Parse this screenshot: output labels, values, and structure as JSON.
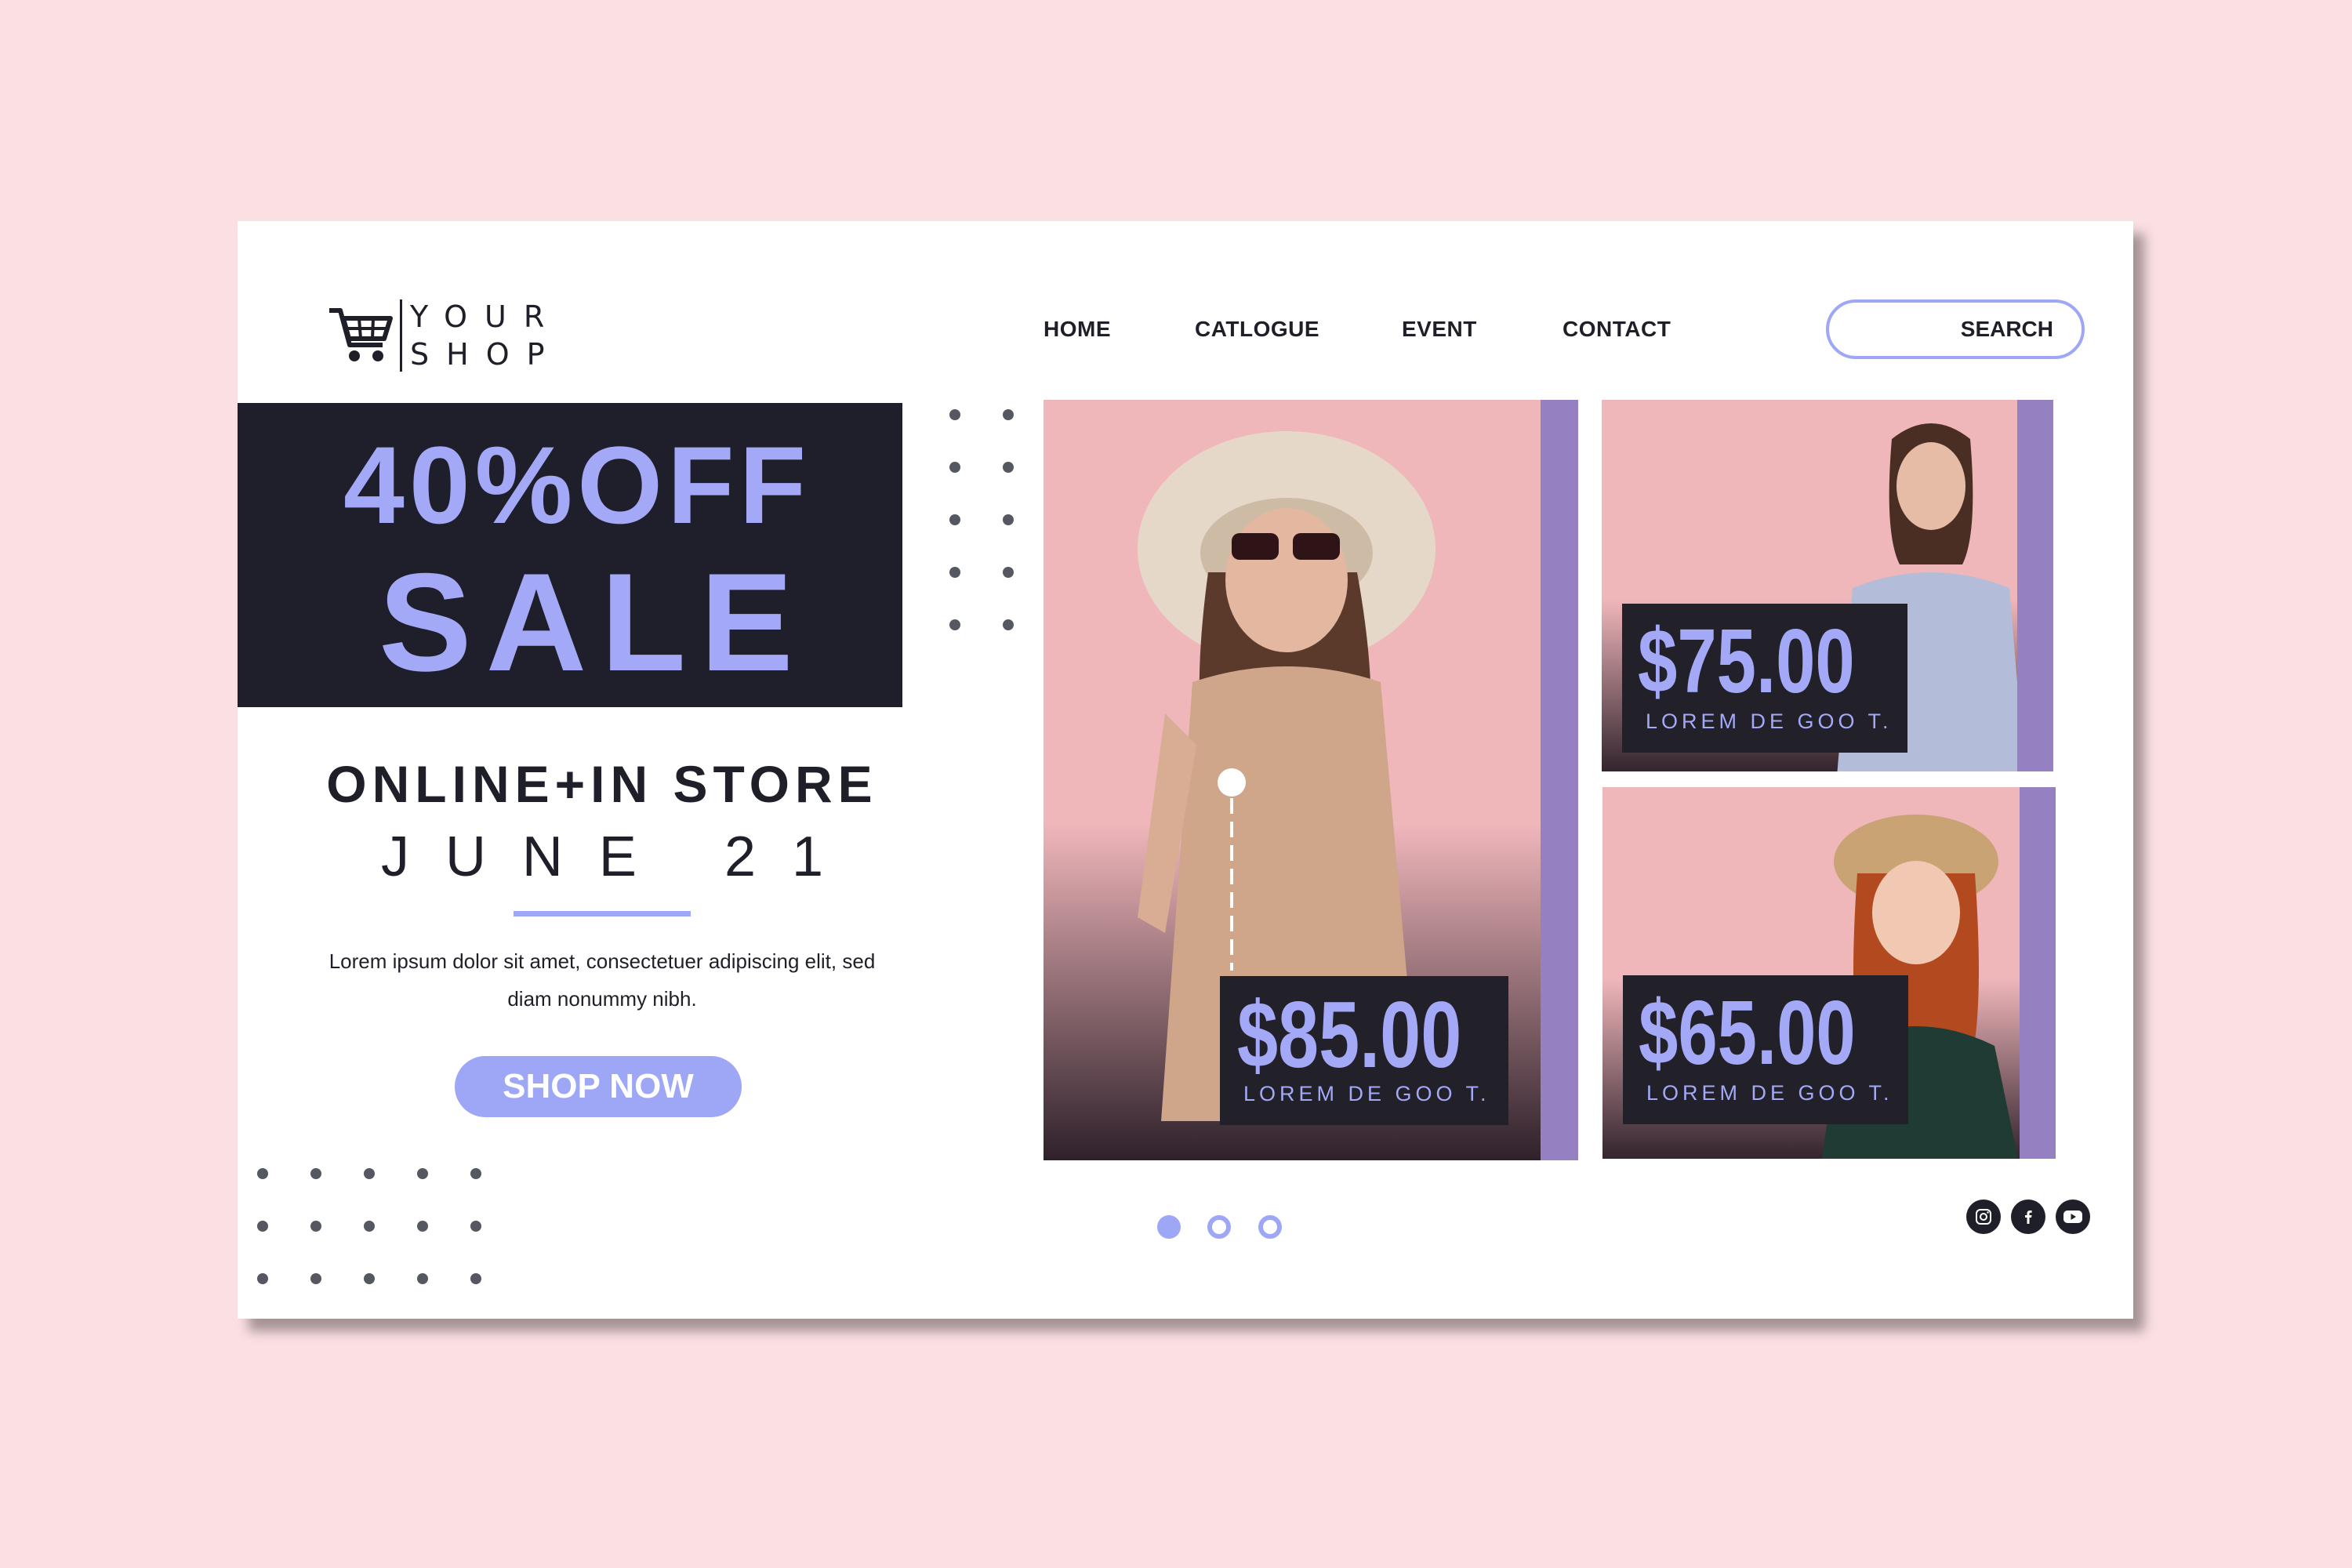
{
  "logo": {
    "line1": "YOUR",
    "line2": "SHOP",
    "icon": "shopping-cart-icon"
  },
  "nav": {
    "home": "HOME",
    "catalogue": "CATLOGUE",
    "event": "EVENT",
    "contact": "CONTACT",
    "search_label": "SEARCH"
  },
  "hero": {
    "discount": "40%OFF",
    "sale": "SALE",
    "channels": "ONLINE+IN STORE",
    "date": "JUNE 21",
    "description": "Lorem ipsum dolor sit amet, consectetuer adipiscing elit, sed diam nonummy nibh.",
    "cta": "SHOP NOW"
  },
  "products": [
    {
      "price": "$85.00",
      "caption": "LOREM DE GOO T."
    },
    {
      "price": "$75.00",
      "caption": "LOREM DE GOO T."
    },
    {
      "price": "$65.00",
      "caption": "LOREM DE GOO T."
    }
  ],
  "pagination": {
    "pages": 3,
    "active": 1
  },
  "social": [
    "instagram-icon",
    "facebook-icon",
    "youtube-icon"
  ],
  "colors": {
    "background": "#fbe0e3",
    "accent": "#9ea7f5",
    "dark": "#1f1f2b",
    "stripe": "#9580c2",
    "photo_pink": "#f0b7bb"
  }
}
